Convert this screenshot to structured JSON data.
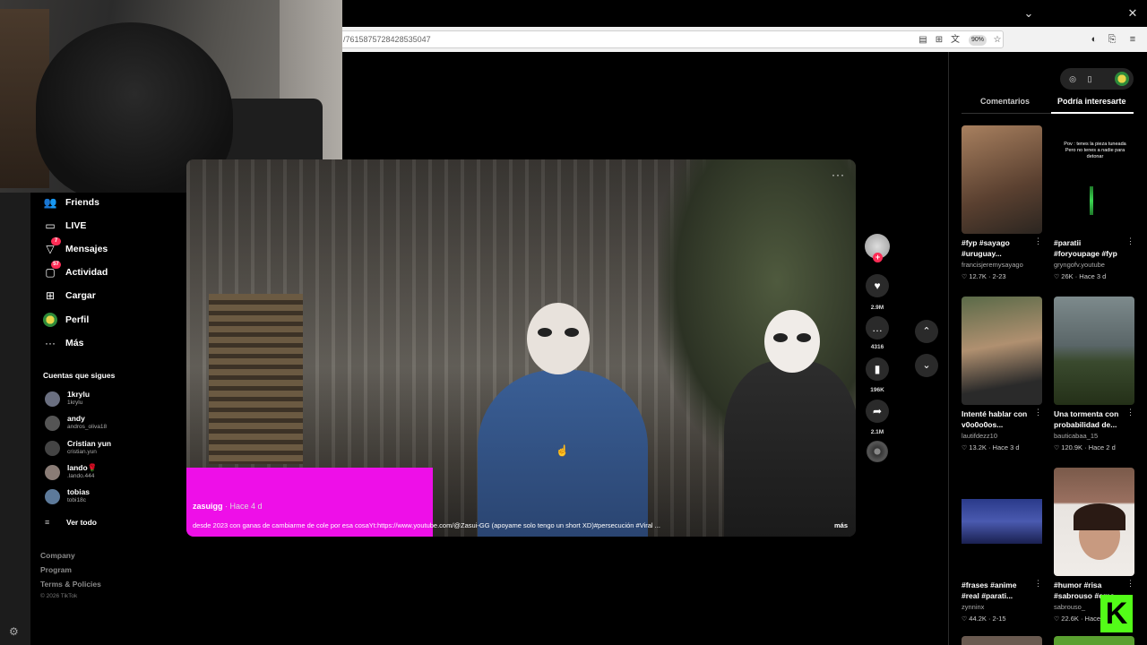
{
  "browser": {
    "url": "/7615875728428535047",
    "zoom": "90%"
  },
  "sidebar": {
    "nav": [
      {
        "label": "Friends",
        "icon": "friends-icon",
        "badge": ""
      },
      {
        "label": "LIVE",
        "icon": "live-icon",
        "badge": ""
      },
      {
        "label": "Mensajes",
        "icon": "messages-icon",
        "badge": "7"
      },
      {
        "label": "Actividad",
        "icon": "activity-icon",
        "badge": "57"
      },
      {
        "label": "Cargar",
        "icon": "upload-icon",
        "badge": ""
      },
      {
        "label": "Perfil",
        "icon": "profile-avatar",
        "badge": ""
      },
      {
        "label": "Más",
        "icon": "more-icon",
        "badge": ""
      }
    ],
    "following_title": "Cuentas que sigues",
    "following": [
      {
        "name": "1krylu",
        "handle": "1krylu"
      },
      {
        "name": "andy",
        "handle": "andros_oliva18"
      },
      {
        "name": "Cristian yun",
        "handle": "cristian.yun"
      },
      {
        "name": "lando🌹",
        "handle": ".lando.444"
      },
      {
        "name": "tobias",
        "handle": "tobi18c"
      }
    ],
    "see_all": "Ver todo",
    "footer": [
      "Company",
      "Program",
      "Terms & Policies"
    ],
    "copyright": "© 2026 TikTok"
  },
  "video": {
    "author": "zasuigg",
    "time": " · Hace 4 d",
    "description": "desde 2023 con ganas de cambiarme de cole por esa cosaYt:https://www.youtube.com/@Zasui-GG (apoyame solo tengo un short XD)#persecución #Viral ...",
    "more": "más",
    "options": "···"
  },
  "actions": {
    "likes": "2.9M",
    "comments": "4316",
    "saves": "196K",
    "shares": "2.1M"
  },
  "right_panel": {
    "tabs": [
      "Comentarios",
      "Podría interesarte"
    ],
    "active_tab": 1,
    "cards": [
      {
        "title": "#fyp #sayago #uruguay...",
        "author": "francisjeremysayago",
        "stats": "12.7K · 2-23",
        "thumb_text": ""
      },
      {
        "title": "#paratii #foryoupage #fyp",
        "author": "gryngofv.youtube",
        "stats": "26K · Hace 3 d",
        "thumb_text": "Pov : tenes la pieza tuneada Pero no tenes a nadie para detonar"
      },
      {
        "title": "Intenté hablar con v0o0o0os...",
        "author": "lautifdezz10",
        "stats": "13.2K · Hace 3 d",
        "thumb_text": ""
      },
      {
        "title": "Una tormenta con probabilidad de...",
        "author": "bauticabaa_15",
        "stats": "120.9K · Hace 2 d",
        "thumb_text": ""
      },
      {
        "title": "#frases #anime #real #parati...",
        "author": "zynninx",
        "stats": "44.2K · 2-15",
        "thumb_text": ""
      },
      {
        "title": "#humor #risa #sabrouso #ome...",
        "author": "sabrouso_",
        "stats": "22.6K · Hace 3 d",
        "thumb_text": ""
      }
    ]
  },
  "colors": {
    "accent": "#fe2c55",
    "highlight": "#ee0fe8",
    "kick": "#53fc18"
  }
}
